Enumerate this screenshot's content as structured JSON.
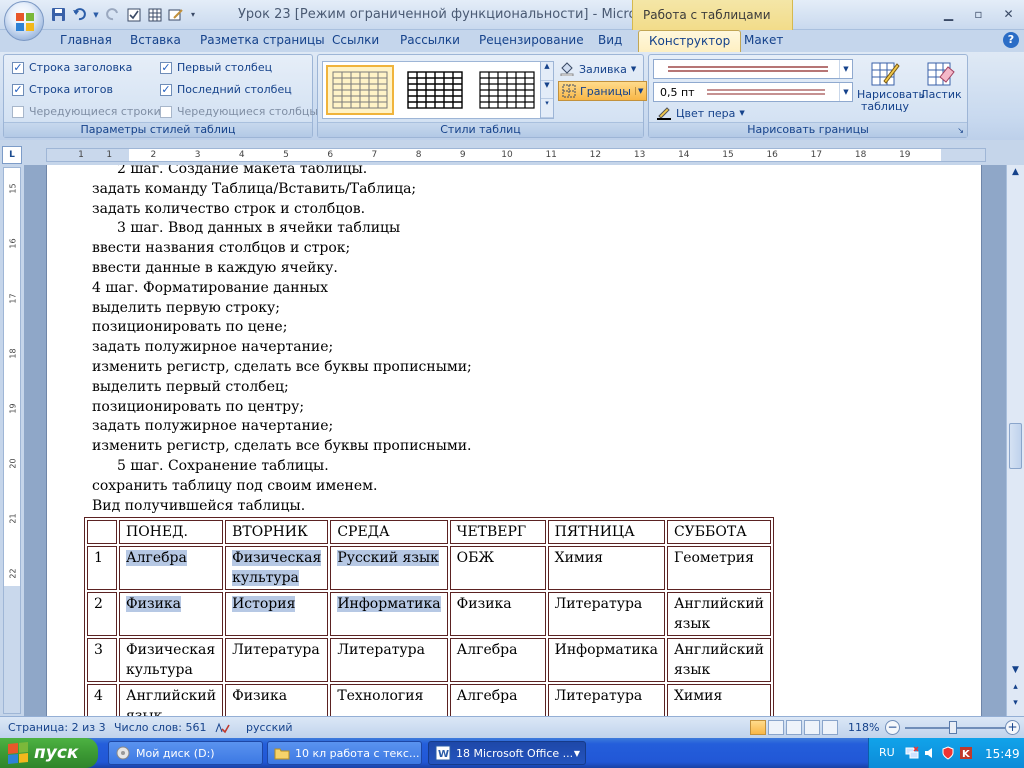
{
  "titlebar": {
    "document_title": "Урок 23 [Режим ограниченной функциональности] - Microsoft...",
    "context_tab_label": "Работа с таблицами"
  },
  "ribbon_tabs": [
    {
      "label": "Главная"
    },
    {
      "label": "Вставка"
    },
    {
      "label": "Разметка страницы"
    },
    {
      "label": "Ссылки"
    },
    {
      "label": "Рассылки"
    },
    {
      "label": "Рецензирование"
    },
    {
      "label": "Вид"
    },
    {
      "label": "Конструктор",
      "active": true
    },
    {
      "label": "Макет"
    }
  ],
  "style_options": {
    "title": "Параметры стилей таблиц",
    "checkboxes": [
      {
        "label": "Строка заголовка",
        "checked": true
      },
      {
        "label": "Первый столбец",
        "checked": true
      },
      {
        "label": "Строка итогов",
        "checked": true
      },
      {
        "label": "Последний столбец",
        "checked": true
      },
      {
        "label": "Чередующиеся строки",
        "checked": false
      },
      {
        "label": "Чередующиеся столбцы",
        "checked": false
      }
    ]
  },
  "table_styles": {
    "title": "Стили таблиц",
    "shading_label": "Заливка",
    "borders_label": "Границы"
  },
  "draw_borders": {
    "title": "Нарисовать границы",
    "line_weight": "0,5 пт",
    "pen_color_label": "Цвет пера",
    "draw_table_label": "Нарисовать таблицу",
    "eraser_label": "Ластик"
  },
  "document": {
    "lines": [
      {
        "text": "2 шаг. Создание макета таблицы.",
        "indent": true
      },
      {
        "text": "задать команду Таблица/Вставить/Таблица;",
        "indent": false
      },
      {
        "text": "задать количество строк и столбцов.",
        "indent": false
      },
      {
        "text": "3 шаг. Ввод данных в ячейки таблицы",
        "indent": true
      },
      {
        "text": "ввести названия столбцов и строк;",
        "indent": false
      },
      {
        "text": "ввести данные в каждую ячейку.",
        "indent": false
      },
      {
        "text": "4 шаг. Форматирование данных",
        "indent": false
      },
      {
        "text": "выделить первую строку;",
        "indent": false
      },
      {
        "text": "позиционировать по цене;",
        "indent": false
      },
      {
        "text": "задать полужирное начертание;",
        "indent": false
      },
      {
        "text": "изменить регистр, сделать все буквы прописными;",
        "indent": false
      },
      {
        "text": "выделить первый столбец;",
        "indent": false
      },
      {
        "text": "позиционировать по центру;",
        "indent": false
      },
      {
        "text": "задать полужирное начертание;",
        "indent": false
      },
      {
        "text": "изменить регистр, сделать все буквы прописными.",
        "indent": false
      },
      {
        "text": "5 шаг. Сохранение таблицы.",
        "indent": true
      },
      {
        "text": "сохранить таблицу под своим именем.",
        "indent": false
      },
      {
        "text": "Вид получившейся таблицы.",
        "indent": false
      }
    ],
    "table": {
      "header": [
        "",
        "ПОНЕД.",
        "ВТОРНИК",
        "СРЕДА",
        "ЧЕТВЕРГ",
        "ПЯТНИЦА",
        "СУББОТА"
      ],
      "rows": [
        [
          "1",
          "Алгебра",
          "Физическая культура",
          "Русский язык",
          "ОБЖ",
          "Химия",
          "Геометрия"
        ],
        [
          "2",
          "Физика",
          "История",
          "Информатика",
          "Физика",
          "Литература",
          "Английский язык"
        ],
        [
          "3",
          "Физическая культура",
          "Литература",
          "Литература",
          "Алгебра",
          "Информатика",
          "Английский язык"
        ],
        [
          "4",
          "Английский язык",
          "Физика",
          "Технология",
          "Алгебра",
          "Литература",
          "Химия"
        ]
      ],
      "highlighted_cells": [
        [
          0,
          1
        ],
        [
          0,
          2
        ],
        [
          0,
          3
        ],
        [
          1,
          1
        ],
        [
          1,
          2
        ],
        [
          1,
          3
        ]
      ]
    }
  },
  "ruler": {
    "h_numbers": [
      "1",
      "1",
      "2",
      "3",
      "4",
      "5",
      "6",
      "7",
      "8",
      "9",
      "10",
      "11",
      "12",
      "13",
      "14",
      "15",
      "16",
      "17",
      "18",
      "19"
    ],
    "v_numbers": [
      "15",
      "16",
      "17",
      "18",
      "19",
      "20",
      "21",
      "22",
      "1",
      "2"
    ]
  },
  "statusbar": {
    "page": "Страница: 2 из 3",
    "words": "Число слов: 561",
    "language": "русский",
    "zoom": "118%"
  },
  "taskbar": {
    "start_label": "пуск",
    "tasks": [
      {
        "label": "Мой диск (D:)",
        "active": false
      },
      {
        "label": "10 кл работа с текс...",
        "active": false
      },
      {
        "label": "18 Microsoft Office ...",
        "active": true
      }
    ],
    "language": "RU",
    "clock": "15:49"
  },
  "colors": {
    "ribbon_blue": "#c5d5ea",
    "active_tab": "#fdefc1",
    "highlight": "#b6c8e4",
    "table_border": "#5b2222",
    "taskbar": "#245edb",
    "start_green": "#3c9a34"
  }
}
